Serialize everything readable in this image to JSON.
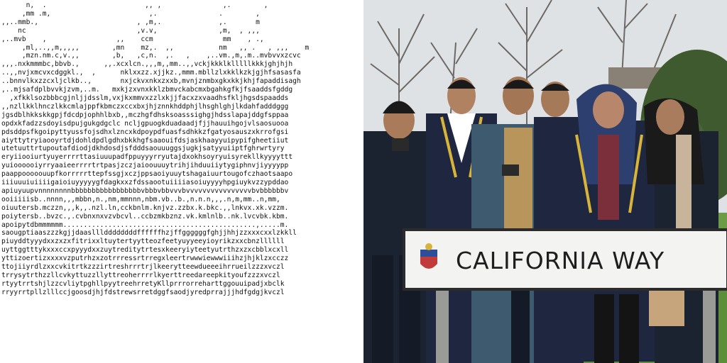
{
  "ascii_art": {
    "lines": [
      "      n,  .                        ,, ,               ,.        ,",
      "     ,mm .m,                        ,.               .        ,",
      ",,..mmb.,                        , ,m,.              ,.       m",
      "    nc                           ,v.v,               ,m,  , ,,,",
      ",..mvb    ,                 ,,    ccm                 mm    , .,",
      "     ,ml,..,,m,,,,,        ,mn    mz,.  ,,           nm   ,, .   , ,,,    m",
      "     ,mzn.nm.c,v.,,        ,b,   ,c,n.  ,.   ,    ,..vm.,m,.m..mvbvvxzcvc",
      ",,,.nxkmmmbc,bbvb.,      ,,.xcxlcn.,,,m,,mm..,,vckjkkklklllllkkkjghjhjh",
      "..,,nvjxmcvxcdggkl.,  ,      nklxxzz.xjjkz.,mmm.mbllzlxkklkzkjgjhfsasasfa",
      "..bnnvlkxzzcxljclkb..,       nxjckvxnkxzxxb,mvnjznmbxgkxkkjkhjfapaddisagh",
      ",..mjsafdplbvvkjzvm,..m.   mxkjzxvnxkklzbmvckabcmxbgahkgfkjfsaaddsfgddg",
      "  ,xfkklsozbbbcgjnljjdsslm,vxjkxmmvxzzlxkjjfacxzxvaadhsfkljhgsdspaadds",
      ",,nzllkklhnczlkkcmlajppfkbmczxccxbxjhjznnkhddphjlhsghlghjlkdahfadddggg",
      "jgsdblhkkskkgpjfdcdpjophhlbxb,,mczhgfdhsksoasssighgjhdsslapajddgfsppaa",
      "opdxkfadzzsdoyisdpujgukgdgclc ncljgpuogkduadaadjfjjhauuihgojvlsaosuooa",
      "pdsddpsfkgoipyttyussfojsdhxlzncxkdpoypdfuasfsdhkkzfgatyosauszxkrrofgsi",
      "aiyttytryiaooyrtdjdohldpdlgdhxbkkhgfsaaouifdsjaskhaayyuipypifgheetiiut",
      "utetuuttrtupoutafdiodjdkhdosdjsfdddsaouuuggsjugkjsatyyuiiptfghrwrtyry",
      "eryiiooiurtyuyerrrrttasiuuupadfppuyyyrryutajdxokhsoyryuisyrekllkyyyyttt",
      "yuioooooiyrryaaieerrrrtrtpasjzczjaioouuuytrihjihduuiiytygiphnvjiyyyypp",
      "paappooooouupfkorrrrrttepfssgjxczjppsaoiyuuytshagaiuurtougofczhaotsaapo",
      "iiiuuuiuiiiigaioiuyyyyygfdagkxxzfdssaootuiiiiasoiuyyyyhpgiuykvzzypddao",
      "apiuyuupvnnnnnnnnbbbbbbbbbbbbbbbbbvbbbvbbvvvbvvvvvvvvvvvvvvvvbvbbbbbbv",
      "ooiiiiisb..nnnn,,,mbbn,n.,nm,mmnnn,nbm.vb..b.,n.n.n,,,.n,m,mm..n,mm,",
      "oiuutersb.mczzn,,,k,,.nzl.ln,cckbnlm.knjvz.zzbx.k.bkc.,,lnkvx.xk.vzzm.",
      "poiytersb..bvzc.,.cvbnxnxvzvbcvl..ccbzmkbznz.vk.kmlnlb..nk.lvcvbk.kbm.",
      "apoipytdbmmmmmm...............................................,.....m.",
      "saougptiaaszzzkgjjdaaslllddddddddffffffhzjffggggggfghjjhhjzzxxxcxxlzkkll",
      "piuyddtyyydxxzxzxfitrixxltuytertyytteozfeetyuyyeeyioyrikzxxcbnzllllll",
      "uyttggtttykxxxccxpyyydxxzuytreditytrtesxkeeryiyteetyutrthzxzxcbblxcxll",
      "yttizoertizxxxxvzputrhzxzotrrressrtrregxleertrwwwiewwwiiihzjhjklzxcczz",
      "ttojiiyrdlzxxcvkitrtkzzzirtreshrrrtrjlkeerytteewdueeeihrrueilzzzxvczl",
      "trrysytrthzzllcvkyttuzzllyttreoherrrrlkyerttreedareepkityoufzzzxvczl",
      "rtyytrrtshjlzzcvliytpghllpyytreehrretyKllprrrorreharttggouuipadjxbclk",
      "rryyrrtpllzlllccjgoosdjhjfdstrewsrretdggfsaodjyredprrajjjhdfgdgjkvczl"
    ]
  },
  "photo": {
    "description_colors": {
      "sky": "#e4e6e8",
      "grass": "#5d8f3a",
      "uniform_navy": "#1f2740",
      "gold_trim": "#d9b43a",
      "sign_bg": "#f3f3f1"
    },
    "sign": {
      "text": "CALIFORNIA WAY"
    }
  }
}
